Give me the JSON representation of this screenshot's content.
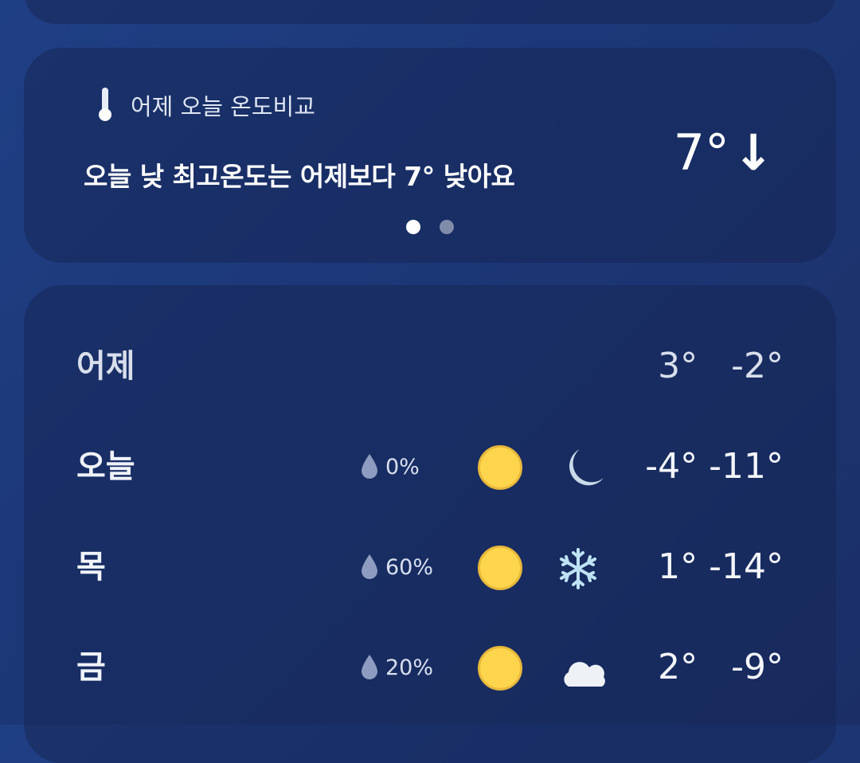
{
  "compare": {
    "icon": "thermometer-icon",
    "title": "어제 오늘 온도비교",
    "message": "오늘 낮 최고온도는 어제보다 7° 낮아요",
    "diff_value": "7°",
    "diff_arrow": "↓",
    "page_count": 2,
    "active_page": 1
  },
  "forecast": [
    {
      "day": "어제",
      "temps": "3°   -2°"
    },
    {
      "day": "오늘",
      "precip_icon": "raindrop-icon",
      "precip": "0%",
      "day_icon": "sun-icon",
      "night_icon": "moon-icon",
      "temps": "-4° -11°"
    },
    {
      "day": "목",
      "precip_icon": "raindrop-half-icon",
      "precip": "60%",
      "day_icon": "sun-icon",
      "night_icon": "snowflake-icon",
      "temps": "1° -14°"
    },
    {
      "day": "금",
      "precip_icon": "raindrop-icon",
      "precip": "20%",
      "day_icon": "sun-icon",
      "night_icon": "cloud-moon-icon",
      "temps": "2°   -9°"
    }
  ],
  "colors": {
    "background": "#1e3a7b",
    "card": "#1a2c62",
    "sun": "#ffd54d",
    "moon": "#c9dbe8",
    "snow": "#bfe3f5"
  }
}
